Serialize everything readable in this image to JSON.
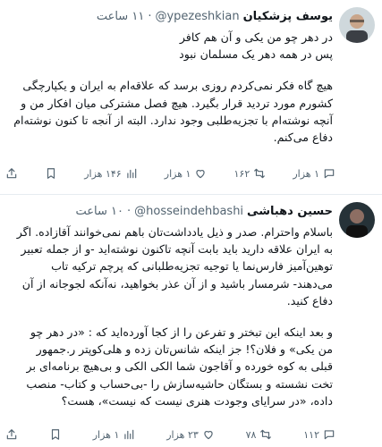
{
  "tweets": [
    {
      "name": "یوسف پزشکیان",
      "handle": "@ypezeshkian",
      "time": "۱۱ ساعت",
      "lines": [
        [
          "در دهر چو من یکی و آن هم کافر",
          "پس در همه دهر یک مسلمان نبود"
        ],
        [
          "هیچ گاه فکر نمی‌کردم روزی برسد که علاقه‌ام به ایران و یکپارچگی کشورم مورد تردید قرار بگیرد. هیچ فصل مشترکی میان افکار من و آنچه نوشته‌ام با تجزیه‌طلبی وجود ندارد. البته از آنجه تا کنون نوشته‌ام دفاع می‌کنم."
        ]
      ],
      "actions": {
        "reply": "۱ هزار",
        "retweet": "۱۶۲",
        "like": "۱ هزار",
        "views": "۱۴۶ هزار"
      }
    },
    {
      "name": "حسین دهباشی",
      "handle": "@hosseindehbashi",
      "time": "۱۰ ساعت",
      "lines": [
        [
          "باسلام واحترام. صدر و ذیل یادداشت‌تان باهم نمی‌خوانند آقازاده. اگر به ایران علاقه دارید باید بابت آنچه تاکنون نوشته‌اید -و از جمله تعبیر توهین‌آمیز فارس‌نما یا توجیه تجزیه‌طلبانی که پرچم ترکیه تاب می‌دهند- شرمسار باشید و از آن عذر بخواهید، نه‌آنکه لجوجانه از آن دفاع کنید."
        ],
        [
          "و بعد اینکه این تبختر و تفرعن را از کجا آورده‌اید که : «در دهر چو من یکی» و فلان؟! جز اینکه شانس‌تان زده و هلی‌کوپتر ر.جمهور قبلی به کوه خورده و آقاجون شما الکی الکی و بی‌هیچ برنامه‌ای بر تخت نشسته و بستگان حاشیه‌سازش را -بی‌حساب و کتاب- منصب داده، «در سرایای وجودت هنری نیست که نیست»، هست؟"
        ]
      ],
      "actions": {
        "reply": "۱۱۲",
        "retweet": "۷۸",
        "like": "۲۳ هزار",
        "views": "۱ هزار"
      }
    }
  ]
}
